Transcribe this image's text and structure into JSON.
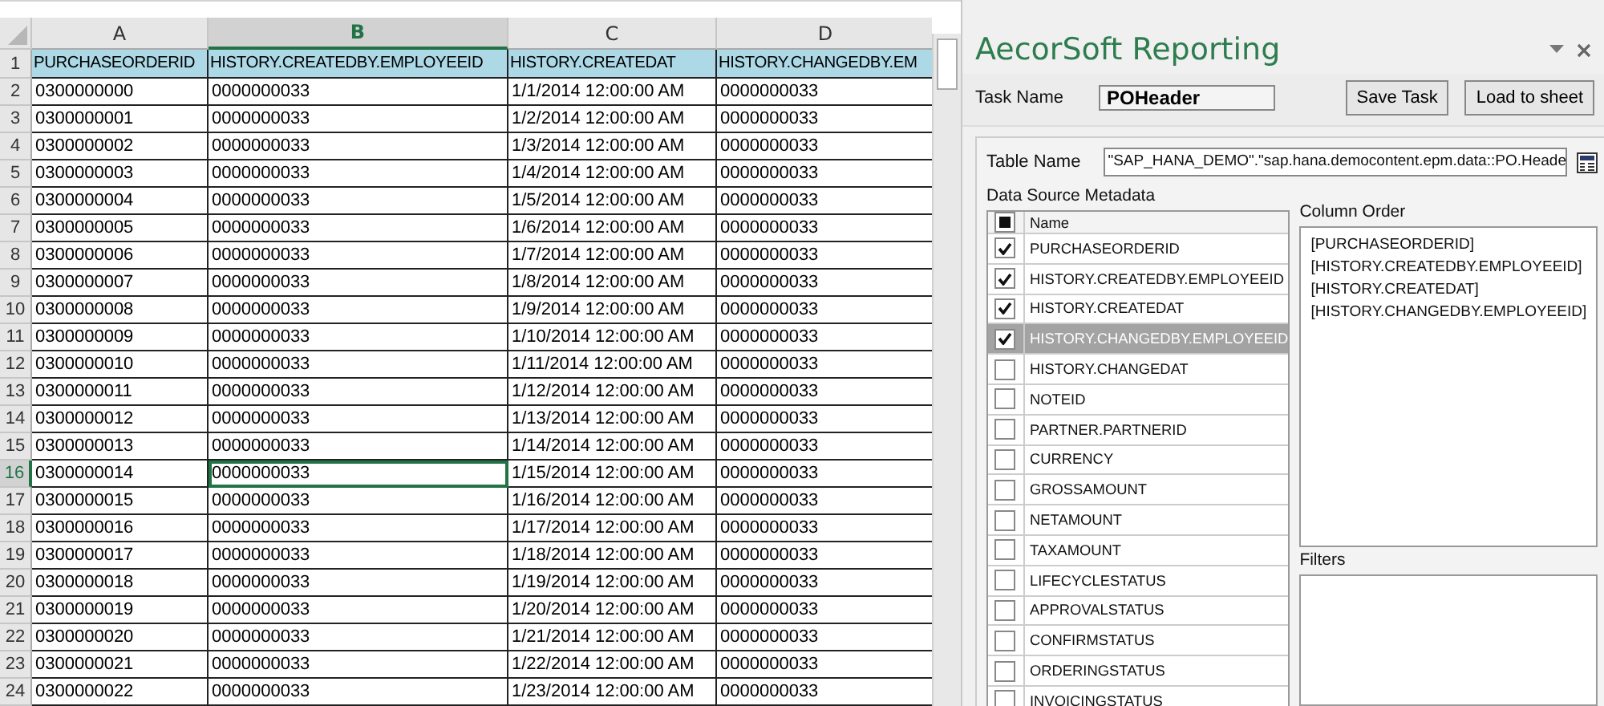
{
  "sheet": {
    "columns": [
      {
        "letter": "A",
        "selected": false
      },
      {
        "letter": "B",
        "selected": true
      },
      {
        "letter": "C",
        "selected": false
      },
      {
        "letter": "D",
        "selected": false
      }
    ],
    "rows": [
      {
        "number": "1",
        "selected": false,
        "kind": "header",
        "cells": [
          {
            "text": "PURCHASEORDERID",
            "selected": false
          },
          {
            "text": "HISTORY.CREATEDBY.EMPLOYEEID",
            "selected": false
          },
          {
            "text": "HISTORY.CREATEDAT",
            "selected": false
          },
          {
            "text": "HISTORY.CHANGEDBY.EM",
            "selected": false
          }
        ]
      },
      {
        "number": "2",
        "selected": false,
        "kind": "data",
        "cells": [
          {
            "text": "0300000000",
            "selected": false
          },
          {
            "text": "0000000033",
            "selected": false
          },
          {
            "text": "1/1/2014 12:00:00 AM",
            "selected": false
          },
          {
            "text": "0000000033",
            "selected": false
          }
        ]
      },
      {
        "number": "3",
        "selected": false,
        "kind": "data",
        "cells": [
          {
            "text": "0300000001",
            "selected": false
          },
          {
            "text": "0000000033",
            "selected": false
          },
          {
            "text": "1/2/2014 12:00:00 AM",
            "selected": false
          },
          {
            "text": "0000000033",
            "selected": false
          }
        ]
      },
      {
        "number": "4",
        "selected": false,
        "kind": "data",
        "cells": [
          {
            "text": "0300000002",
            "selected": false
          },
          {
            "text": "0000000033",
            "selected": false
          },
          {
            "text": "1/3/2014 12:00:00 AM",
            "selected": false
          },
          {
            "text": "0000000033",
            "selected": false
          }
        ]
      },
      {
        "number": "5",
        "selected": false,
        "kind": "data",
        "cells": [
          {
            "text": "0300000003",
            "selected": false
          },
          {
            "text": "0000000033",
            "selected": false
          },
          {
            "text": "1/4/2014 12:00:00 AM",
            "selected": false
          },
          {
            "text": "0000000033",
            "selected": false
          }
        ]
      },
      {
        "number": "6",
        "selected": false,
        "kind": "data",
        "cells": [
          {
            "text": "0300000004",
            "selected": false
          },
          {
            "text": "0000000033",
            "selected": false
          },
          {
            "text": "1/5/2014 12:00:00 AM",
            "selected": false
          },
          {
            "text": "0000000033",
            "selected": false
          }
        ]
      },
      {
        "number": "7",
        "selected": false,
        "kind": "data",
        "cells": [
          {
            "text": "0300000005",
            "selected": false
          },
          {
            "text": "0000000033",
            "selected": false
          },
          {
            "text": "1/6/2014 12:00:00 AM",
            "selected": false
          },
          {
            "text": "0000000033",
            "selected": false
          }
        ]
      },
      {
        "number": "8",
        "selected": false,
        "kind": "data",
        "cells": [
          {
            "text": "0300000006",
            "selected": false
          },
          {
            "text": "0000000033",
            "selected": false
          },
          {
            "text": "1/7/2014 12:00:00 AM",
            "selected": false
          },
          {
            "text": "0000000033",
            "selected": false
          }
        ]
      },
      {
        "number": "9",
        "selected": false,
        "kind": "data",
        "cells": [
          {
            "text": "0300000007",
            "selected": false
          },
          {
            "text": "0000000033",
            "selected": false
          },
          {
            "text": "1/8/2014 12:00:00 AM",
            "selected": false
          },
          {
            "text": "0000000033",
            "selected": false
          }
        ]
      },
      {
        "number": "10",
        "selected": false,
        "kind": "data",
        "cells": [
          {
            "text": "0300000008",
            "selected": false
          },
          {
            "text": "0000000033",
            "selected": false
          },
          {
            "text": "1/9/2014 12:00:00 AM",
            "selected": false
          },
          {
            "text": "0000000033",
            "selected": false
          }
        ]
      },
      {
        "number": "11",
        "selected": false,
        "kind": "data",
        "cells": [
          {
            "text": "0300000009",
            "selected": false
          },
          {
            "text": "0000000033",
            "selected": false
          },
          {
            "text": "1/10/2014 12:00:00 AM",
            "selected": false
          },
          {
            "text": "0000000033",
            "selected": false
          }
        ]
      },
      {
        "number": "12",
        "selected": false,
        "kind": "data",
        "cells": [
          {
            "text": "0300000010",
            "selected": false
          },
          {
            "text": "0000000033",
            "selected": false
          },
          {
            "text": "1/11/2014 12:00:00 AM",
            "selected": false
          },
          {
            "text": "0000000033",
            "selected": false
          }
        ]
      },
      {
        "number": "13",
        "selected": false,
        "kind": "data",
        "cells": [
          {
            "text": "0300000011",
            "selected": false
          },
          {
            "text": "0000000033",
            "selected": false
          },
          {
            "text": "1/12/2014 12:00:00 AM",
            "selected": false
          },
          {
            "text": "0000000033",
            "selected": false
          }
        ]
      },
      {
        "number": "14",
        "selected": false,
        "kind": "data",
        "cells": [
          {
            "text": "0300000012",
            "selected": false
          },
          {
            "text": "0000000033",
            "selected": false
          },
          {
            "text": "1/13/2014 12:00:00 AM",
            "selected": false
          },
          {
            "text": "0000000033",
            "selected": false
          }
        ]
      },
      {
        "number": "15",
        "selected": false,
        "kind": "data",
        "cells": [
          {
            "text": "0300000013",
            "selected": false
          },
          {
            "text": "0000000033",
            "selected": false
          },
          {
            "text": "1/14/2014 12:00:00 AM",
            "selected": false
          },
          {
            "text": "0000000033",
            "selected": false
          }
        ]
      },
      {
        "number": "16",
        "selected": true,
        "kind": "data",
        "cells": [
          {
            "text": "0300000014",
            "selected": false
          },
          {
            "text": "0000000033",
            "selected": true
          },
          {
            "text": "1/15/2014 12:00:00 AM",
            "selected": false
          },
          {
            "text": "0000000033",
            "selected": false
          }
        ]
      },
      {
        "number": "17",
        "selected": false,
        "kind": "data",
        "cells": [
          {
            "text": "0300000015",
            "selected": false
          },
          {
            "text": "0000000033",
            "selected": false
          },
          {
            "text": "1/16/2014 12:00:00 AM",
            "selected": false
          },
          {
            "text": "0000000033",
            "selected": false
          }
        ]
      },
      {
        "number": "18",
        "selected": false,
        "kind": "data",
        "cells": [
          {
            "text": "0300000016",
            "selected": false
          },
          {
            "text": "0000000033",
            "selected": false
          },
          {
            "text": "1/17/2014 12:00:00 AM",
            "selected": false
          },
          {
            "text": "0000000033",
            "selected": false
          }
        ]
      },
      {
        "number": "19",
        "selected": false,
        "kind": "data",
        "cells": [
          {
            "text": "0300000017",
            "selected": false
          },
          {
            "text": "0000000033",
            "selected": false
          },
          {
            "text": "1/18/2014 12:00:00 AM",
            "selected": false
          },
          {
            "text": "0000000033",
            "selected": false
          }
        ]
      },
      {
        "number": "20",
        "selected": false,
        "kind": "data",
        "cells": [
          {
            "text": "0300000018",
            "selected": false
          },
          {
            "text": "0000000033",
            "selected": false
          },
          {
            "text": "1/19/2014 12:00:00 AM",
            "selected": false
          },
          {
            "text": "0000000033",
            "selected": false
          }
        ]
      },
      {
        "number": "21",
        "selected": false,
        "kind": "data",
        "cells": [
          {
            "text": "0300000019",
            "selected": false
          },
          {
            "text": "0000000033",
            "selected": false
          },
          {
            "text": "1/20/2014 12:00:00 AM",
            "selected": false
          },
          {
            "text": "0000000033",
            "selected": false
          }
        ]
      },
      {
        "number": "22",
        "selected": false,
        "kind": "data",
        "cells": [
          {
            "text": "0300000020",
            "selected": false
          },
          {
            "text": "0000000033",
            "selected": false
          },
          {
            "text": "1/21/2014 12:00:00 AM",
            "selected": false
          },
          {
            "text": "0000000033",
            "selected": false
          }
        ]
      },
      {
        "number": "23",
        "selected": false,
        "kind": "data",
        "cells": [
          {
            "text": "0300000021",
            "selected": false
          },
          {
            "text": "0000000033",
            "selected": false
          },
          {
            "text": "1/22/2014 12:00:00 AM",
            "selected": false
          },
          {
            "text": "0000000033",
            "selected": false
          }
        ]
      },
      {
        "number": "24",
        "selected": false,
        "kind": "data",
        "cells": [
          {
            "text": "0300000022",
            "selected": false
          },
          {
            "text": "0000000033",
            "selected": false
          },
          {
            "text": "1/23/2014 12:00:00 AM",
            "selected": false
          },
          {
            "text": "0000000033",
            "selected": false
          }
        ]
      }
    ]
  },
  "panel": {
    "title": "AecorSoft Reporting",
    "task_name_label": "Task Name",
    "task_name": "POHeader",
    "buttons": [
      "Save Task",
      "Load to sheet"
    ],
    "table_name_label": "Table Name",
    "table_name": "\"SAP_HANA_DEMO\".\"sap.hana.democontent.epm.data::PO.Heade",
    "metadata_label": "Data Source Metadata",
    "metadata_header": {
      "label": "Name",
      "indeterminate": true
    },
    "metadata": [
      {
        "name": "PURCHASEORDERID",
        "checked": true,
        "selected": false
      },
      {
        "name": "HISTORY.CREATEDBY.EMPLOYEEID",
        "checked": true,
        "selected": false
      },
      {
        "name": "HISTORY.CREATEDAT",
        "checked": true,
        "selected": false
      },
      {
        "name": "HISTORY.CHANGEDBY.EMPLOYEEID",
        "checked": true,
        "selected": true
      },
      {
        "name": "HISTORY.CHANGEDAT",
        "checked": false,
        "selected": false
      },
      {
        "name": "NOTEID",
        "checked": false,
        "selected": false
      },
      {
        "name": "PARTNER.PARTNERID",
        "checked": false,
        "selected": false
      },
      {
        "name": "CURRENCY",
        "checked": false,
        "selected": false
      },
      {
        "name": "GROSSAMOUNT",
        "checked": false,
        "selected": false
      },
      {
        "name": "NETAMOUNT",
        "checked": false,
        "selected": false
      },
      {
        "name": "TAXAMOUNT",
        "checked": false,
        "selected": false
      },
      {
        "name": "LIFECYCLESTATUS",
        "checked": false,
        "selected": false
      },
      {
        "name": "APPROVALSTATUS",
        "checked": false,
        "selected": false
      },
      {
        "name": "CONFIRMSTATUS",
        "checked": false,
        "selected": false
      },
      {
        "name": "ORDERINGSTATUS",
        "checked": false,
        "selected": false
      },
      {
        "name": "INVOICINGSTATUS",
        "checked": false,
        "selected": false
      }
    ],
    "column_order_label": "Column Order",
    "column_order": [
      "[PURCHASEORDERID]",
      "[HISTORY.CREATEDBY.EMPLOYEEID]",
      "[HISTORY.CREATEDAT]",
      "[HISTORY.CHANGEDBY.EMPLOYEEID]"
    ],
    "filters_label": "Filters"
  }
}
